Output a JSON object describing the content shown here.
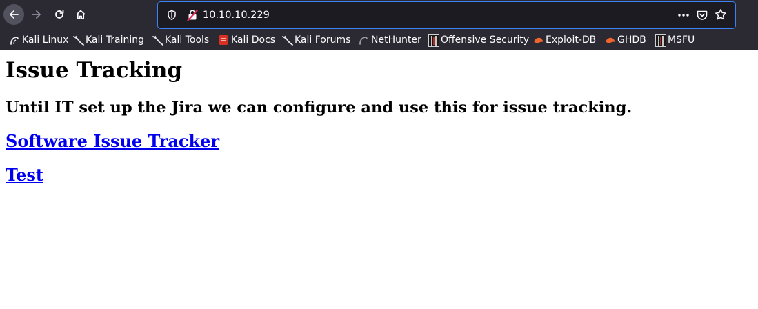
{
  "browser": {
    "url": "10.10.10.229",
    "bookmarks": [
      {
        "label": "Kali Linux",
        "icon": "kali-dragon-icon"
      },
      {
        "label": "Kali Training",
        "icon": "kali-dragon-icon"
      },
      {
        "label": "Kali Tools",
        "icon": "kali-dragon-icon"
      },
      {
        "label": "Kali Docs",
        "icon": "kali-docs-icon"
      },
      {
        "label": "Kali Forums",
        "icon": "kali-dragon-icon"
      },
      {
        "label": "NetHunter",
        "icon": "nethunter-icon"
      },
      {
        "label": "Offensive Security",
        "icon": "offsec-icon"
      },
      {
        "label": "Exploit-DB",
        "icon": "exploit-db-icon"
      },
      {
        "label": "GHDB",
        "icon": "ghdb-icon"
      },
      {
        "label": "MSFU",
        "icon": "msfu-icon"
      }
    ],
    "colors": {
      "chrome": "#2b2a33",
      "urlbar": "#1c1b22",
      "focus": "#3b82f6"
    }
  },
  "page": {
    "title": "Issue Tracking",
    "subtitle": "Until IT set up the Jira we can configure and use this for issue tracking.",
    "links": [
      "Software Issue Tracker",
      "Test"
    ],
    "link_color": "#0000ee"
  }
}
